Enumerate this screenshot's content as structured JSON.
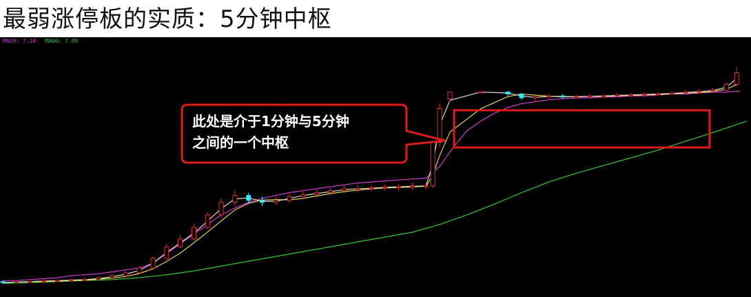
{
  "title": "最弱涨停板的实质：5分钟中枢",
  "ma_legend": [
    {
      "label": "MA20: 7.24",
      "color": "#d23ad2"
    },
    {
      "label": "MA60: 7.09",
      "color": "#2fc82f"
    }
  ],
  "annotation": {
    "line1": "此处是介于1分钟与5分钟",
    "line2": "之间的一个中枢",
    "border_color": "#e01b1b"
  },
  "colors": {
    "up": "#e23131",
    "down": "#37e6ff",
    "ma5": "#d9d9d9",
    "ma10": "#e6d34a",
    "ma20": "#d23ad2",
    "ma60": "#2fc82f",
    "background": "#000000"
  },
  "chart_data": {
    "type": "candlestick",
    "series": [
      {
        "name": "MA20",
        "points": [
          [
            0,
            6.07
          ],
          [
            20,
            6.07
          ],
          [
            40,
            6.08
          ],
          [
            60,
            6.09
          ],
          [
            80,
            6.1
          ],
          [
            100,
            6.12
          ],
          [
            120,
            6.13
          ],
          [
            140,
            6.14
          ],
          [
            160,
            6.16
          ],
          [
            180,
            6.18
          ],
          [
            200,
            6.2
          ],
          [
            220,
            6.25
          ],
          [
            240,
            6.35
          ],
          [
            260,
            6.45
          ],
          [
            280,
            6.55
          ],
          [
            300,
            6.65
          ],
          [
            320,
            6.75
          ],
          [
            340,
            6.82
          ],
          [
            360,
            6.88
          ],
          [
            380,
            6.92
          ],
          [
            400,
            6.95
          ],
          [
            420,
            6.98
          ],
          [
            440,
            7.0
          ],
          [
            460,
            7.02
          ],
          [
            480,
            7.04
          ],
          [
            500,
            7.06
          ],
          [
            520,
            7.08
          ],
          [
            540,
            7.09
          ],
          [
            560,
            7.1
          ],
          [
            580,
            7.11
          ],
          [
            600,
            7.12
          ],
          [
            620,
            7.13
          ],
          [
            640,
            7.25
          ],
          [
            660,
            7.45
          ],
          [
            680,
            7.62
          ],
          [
            700,
            7.72
          ],
          [
            720,
            7.8
          ],
          [
            740,
            7.86
          ],
          [
            760,
            7.9
          ],
          [
            780,
            7.92
          ],
          [
            800,
            7.94
          ],
          [
            820,
            7.95
          ],
          [
            840,
            7.96
          ],
          [
            860,
            7.96
          ],
          [
            880,
            7.97
          ],
          [
            900,
            7.97
          ],
          [
            920,
            7.98
          ],
          [
            940,
            7.98
          ],
          [
            960,
            7.99
          ],
          [
            980,
            8.0
          ],
          [
            1000,
            8.0
          ],
          [
            1020,
            8.01
          ],
          [
            1040,
            8.02
          ],
          [
            1060,
            8.02
          ],
          [
            1080,
            8.03
          ]
        ]
      },
      {
        "name": "MA60",
        "points": [
          [
            0,
            6.04
          ],
          [
            40,
            6.05
          ],
          [
            80,
            6.06
          ],
          [
            120,
            6.07
          ],
          [
            160,
            6.08
          ],
          [
            200,
            6.1
          ],
          [
            240,
            6.13
          ],
          [
            280,
            6.17
          ],
          [
            320,
            6.22
          ],
          [
            360,
            6.27
          ],
          [
            400,
            6.32
          ],
          [
            440,
            6.37
          ],
          [
            480,
            6.42
          ],
          [
            520,
            6.47
          ],
          [
            560,
            6.52
          ],
          [
            600,
            6.57
          ],
          [
            640,
            6.65
          ],
          [
            680,
            6.75
          ],
          [
            720,
            6.86
          ],
          [
            760,
            6.98
          ],
          [
            800,
            7.09
          ],
          [
            840,
            7.18
          ],
          [
            880,
            7.26
          ],
          [
            920,
            7.34
          ],
          [
            960,
            7.42
          ],
          [
            1000,
            7.51
          ],
          [
            1040,
            7.6
          ],
          [
            1090,
            7.72
          ]
        ]
      }
    ],
    "candles_approx": [
      [
        0,
        6.06,
        6.05,
        6.07,
        6.04
      ],
      [
        20,
        6.05,
        6.06,
        6.07,
        6.04
      ],
      [
        40,
        6.06,
        6.06,
        6.07,
        6.05
      ],
      [
        60,
        6.06,
        6.07,
        6.08,
        6.05
      ],
      [
        80,
        6.07,
        6.07,
        6.08,
        6.06
      ],
      [
        100,
        6.07,
        6.08,
        6.09,
        6.06
      ],
      [
        120,
        6.08,
        6.08,
        6.1,
        6.07
      ],
      [
        140,
        6.08,
        6.1,
        6.11,
        6.07
      ],
      [
        160,
        6.1,
        6.12,
        6.14,
        6.09
      ],
      [
        180,
        6.12,
        6.15,
        6.17,
        6.11
      ],
      [
        200,
        6.15,
        6.2,
        6.22,
        6.14
      ],
      [
        220,
        6.2,
        6.3,
        6.32,
        6.18
      ],
      [
        240,
        6.3,
        6.42,
        6.45,
        6.28
      ],
      [
        260,
        6.42,
        6.5,
        6.55,
        6.4
      ],
      [
        280,
        6.5,
        6.62,
        6.66,
        6.48
      ],
      [
        300,
        6.62,
        6.75,
        6.78,
        6.6
      ],
      [
        320,
        6.75,
        6.88,
        6.92,
        6.72
      ],
      [
        340,
        6.88,
        6.95,
        7.0,
        6.84
      ],
      [
        360,
        6.95,
        6.9,
        6.98,
        6.86
      ],
      [
        380,
        6.9,
        6.88,
        6.94,
        6.84
      ],
      [
        400,
        6.88,
        6.9,
        6.94,
        6.85
      ],
      [
        420,
        6.9,
        6.94,
        6.97,
        6.87
      ],
      [
        440,
        6.94,
        6.96,
        6.99,
        6.91
      ],
      [
        460,
        6.96,
        6.98,
        7.01,
        6.93
      ],
      [
        480,
        6.98,
        7.0,
        7.03,
        6.95
      ],
      [
        500,
        7.0,
        7.02,
        7.05,
        6.97
      ],
      [
        520,
        7.02,
        7.02,
        7.06,
        6.98
      ],
      [
        540,
        7.02,
        7.03,
        7.06,
        6.99
      ],
      [
        560,
        7.03,
        7.04,
        7.07,
        7.0
      ],
      [
        580,
        7.04,
        7.04,
        7.07,
        7.0
      ],
      [
        600,
        7.04,
        7.05,
        7.08,
        7.01
      ],
      [
        620,
        7.05,
        7.05,
        7.08,
        7.02
      ],
      [
        630,
        7.05,
        7.5,
        7.55,
        7.03
      ],
      [
        640,
        7.5,
        7.85,
        7.9,
        7.45
      ],
      [
        655,
        7.95,
        8.02,
        8.02,
        7.92
      ],
      [
        700,
        8.02,
        8.02,
        8.02,
        8.02
      ],
      [
        740,
        8.02,
        8.0,
        8.03,
        7.98
      ],
      [
        760,
        8.0,
        7.96,
        8.01,
        7.94
      ],
      [
        780,
        7.96,
        7.97,
        7.99,
        7.93
      ],
      [
        800,
        7.97,
        7.98,
        8.0,
        7.95
      ],
      [
        820,
        7.98,
        7.97,
        8.0,
        7.95
      ],
      [
        840,
        7.97,
        7.97,
        7.99,
        7.95
      ],
      [
        860,
        7.97,
        7.98,
        8.0,
        7.96
      ],
      [
        880,
        7.98,
        7.98,
        8.0,
        7.96
      ],
      [
        900,
        7.98,
        7.99,
        8.01,
        7.97
      ],
      [
        920,
        7.99,
        7.99,
        8.01,
        7.97
      ],
      [
        940,
        7.99,
        8.0,
        8.02,
        7.98
      ],
      [
        960,
        8.0,
        8.0,
        8.02,
        7.98
      ],
      [
        980,
        8.0,
        8.01,
        8.03,
        7.99
      ],
      [
        1000,
        8.01,
        8.02,
        8.04,
        8.0
      ],
      [
        1020,
        8.02,
        8.03,
        8.05,
        8.01
      ],
      [
        1040,
        8.03,
        8.04,
        8.06,
        8.02
      ],
      [
        1060,
        8.04,
        8.1,
        8.12,
        8.03
      ],
      [
        1075,
        8.1,
        8.22,
        8.28,
        8.08
      ]
    ],
    "ylim": [
      5.95,
      8.4
    ],
    "xlim": [
      0,
      1090
    ]
  }
}
